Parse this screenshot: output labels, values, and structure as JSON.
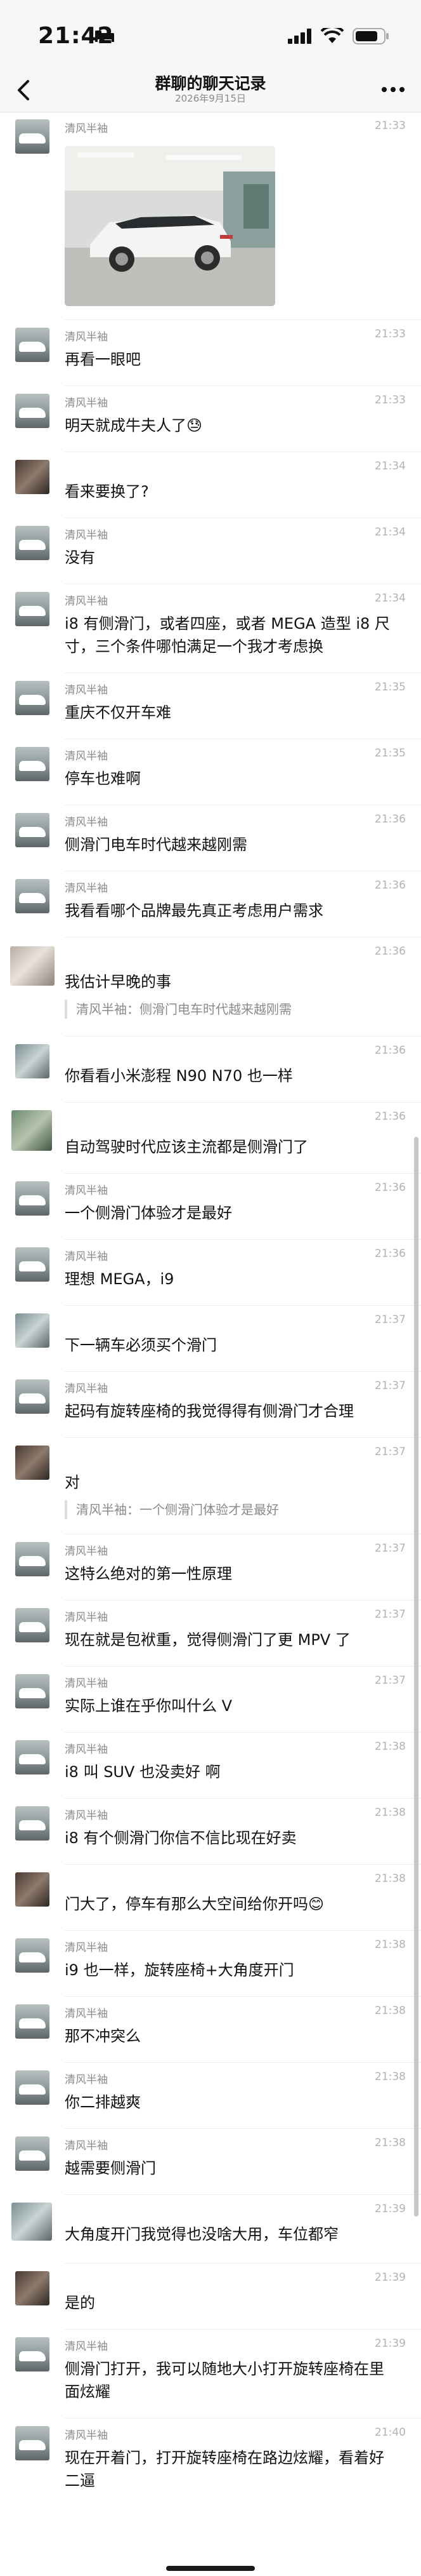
{
  "status_bar": {
    "time": "21:42"
  },
  "nav": {
    "title": "群聊的聊天记录",
    "subtitle": "2026年9月15日"
  },
  "icons": {
    "back": "chevron-left-icon",
    "more": "more-dots-icon",
    "signal": "signal-icon",
    "wifi": "wifi-icon",
    "battery": "battery-icon",
    "bed": "sleep-focus-icon"
  },
  "colors": {
    "background": "#ffffff",
    "nav_background": "#f7f7f7",
    "meta_text": "#8a8a8a",
    "time_text": "#b2b2b2"
  },
  "messages": [
    {
      "sender": "清风半袖",
      "time": "21:33",
      "text": "",
      "avatar": "car",
      "type": "image",
      "image": "white-suv-in-parking-garage"
    },
    {
      "sender": "清风半袖",
      "time": "21:33",
      "text": "再看一眼吧",
      "avatar": "car"
    },
    {
      "sender": "清风半袖",
      "time": "21:33",
      "text": "明天就成牛夫人了😓",
      "avatar": "car"
    },
    {
      "sender": "",
      "time": "21:34",
      "text": "看来要换了?",
      "avatar": "dark"
    },
    {
      "sender": "清风半袖",
      "time": "21:34",
      "text": "没有",
      "avatar": "car"
    },
    {
      "sender": "清风半袖",
      "time": "21:34",
      "text": "i8 有侧滑门，或者四座，或者 MEGA 造型 i8 尺寸，三个条件哪怕满足一个我才考虑换",
      "avatar": "car"
    },
    {
      "sender": "清风半袖",
      "time": "21:35",
      "text": "重庆不仅开车难",
      "avatar": "car"
    },
    {
      "sender": "清风半袖",
      "time": "21:35",
      "text": "停车也难啊",
      "avatar": "car"
    },
    {
      "sender": "清风半袖",
      "time": "21:36",
      "text": "侧滑门电车时代越来越刚需",
      "avatar": "car"
    },
    {
      "sender": "清风半袖",
      "time": "21:36",
      "text": "我看看哪个品牌最先真正考虑用户需求",
      "avatar": "car"
    },
    {
      "sender": "",
      "time": "21:36",
      "text": "我估计早晚的事",
      "avatar": "blur",
      "quote": "清风半袖：侧滑门电车时代越来越刚需"
    },
    {
      "sender": "",
      "time": "21:36",
      "text": "你看看小米澎程 N90 N70 也一样",
      "avatar": "gray"
    },
    {
      "sender": "",
      "time": "21:36",
      "text": "自动驾驶时代应该主流都是侧滑门了",
      "avatar": "green"
    },
    {
      "sender": "清风半袖",
      "time": "21:36",
      "text": "一个侧滑门体验才是最好",
      "avatar": "car"
    },
    {
      "sender": "清风半袖",
      "time": "21:36",
      "text": "理想 MEGA，i9",
      "avatar": "car"
    },
    {
      "sender": "",
      "time": "21:37",
      "text": "下一辆车必须买个滑门",
      "avatar": "gray"
    },
    {
      "sender": "清风半袖",
      "time": "21:37",
      "text": "起码有旋转座椅的我觉得得有侧滑门才合理",
      "avatar": "car"
    },
    {
      "sender": "",
      "time": "21:37",
      "text": "对",
      "avatar": "dark",
      "quote": "清风半袖：一个侧滑门体验才是最好"
    },
    {
      "sender": "清风半袖",
      "time": "21:37",
      "text": "这特么绝对的第一性原理",
      "avatar": "car"
    },
    {
      "sender": "清风半袖",
      "time": "21:37",
      "text": "现在就是包袱重，觉得侧滑门了更 MPV 了",
      "avatar": "car"
    },
    {
      "sender": "清风半袖",
      "time": "21:37",
      "text": "实际上谁在乎你叫什么 V",
      "avatar": "car"
    },
    {
      "sender": "清风半袖",
      "time": "21:38",
      "text": "i8 叫 SUV 也没卖好 啊",
      "avatar": "car"
    },
    {
      "sender": "清风半袖",
      "time": "21:38",
      "text": "i8 有个侧滑门你信不信比现在好卖",
      "avatar": "car"
    },
    {
      "sender": "",
      "time": "21:38",
      "text": "门大了，停车有那么大空间给你开吗😊",
      "avatar": "dark"
    },
    {
      "sender": "清风半袖",
      "time": "21:38",
      "text": "i9 也一样，旋转座椅+大角度开门",
      "avatar": "car"
    },
    {
      "sender": "清风半袖",
      "time": "21:38",
      "text": "那不冲突么",
      "avatar": "car"
    },
    {
      "sender": "清风半袖",
      "time": "21:38",
      "text": "你二排越爽",
      "avatar": "car"
    },
    {
      "sender": "清风半袖",
      "time": "21:38",
      "text": "越需要侧滑门",
      "avatar": "car"
    },
    {
      "sender": "",
      "time": "21:39",
      "text": "大角度开门我觉得也没啥大用，车位都窄",
      "avatar": "gray"
    },
    {
      "sender": "",
      "time": "21:39",
      "text": "是的",
      "avatar": "dark"
    },
    {
      "sender": "清风半袖",
      "time": "21:39",
      "text": "侧滑门打开，我可以随地大小打开旋转座椅在里面炫耀",
      "avatar": "car"
    },
    {
      "sender": "清风半袖",
      "time": "21:40",
      "text": "现在开着门，打开旋转座椅在路边炫耀，看着好二逼",
      "avatar": "car"
    }
  ]
}
